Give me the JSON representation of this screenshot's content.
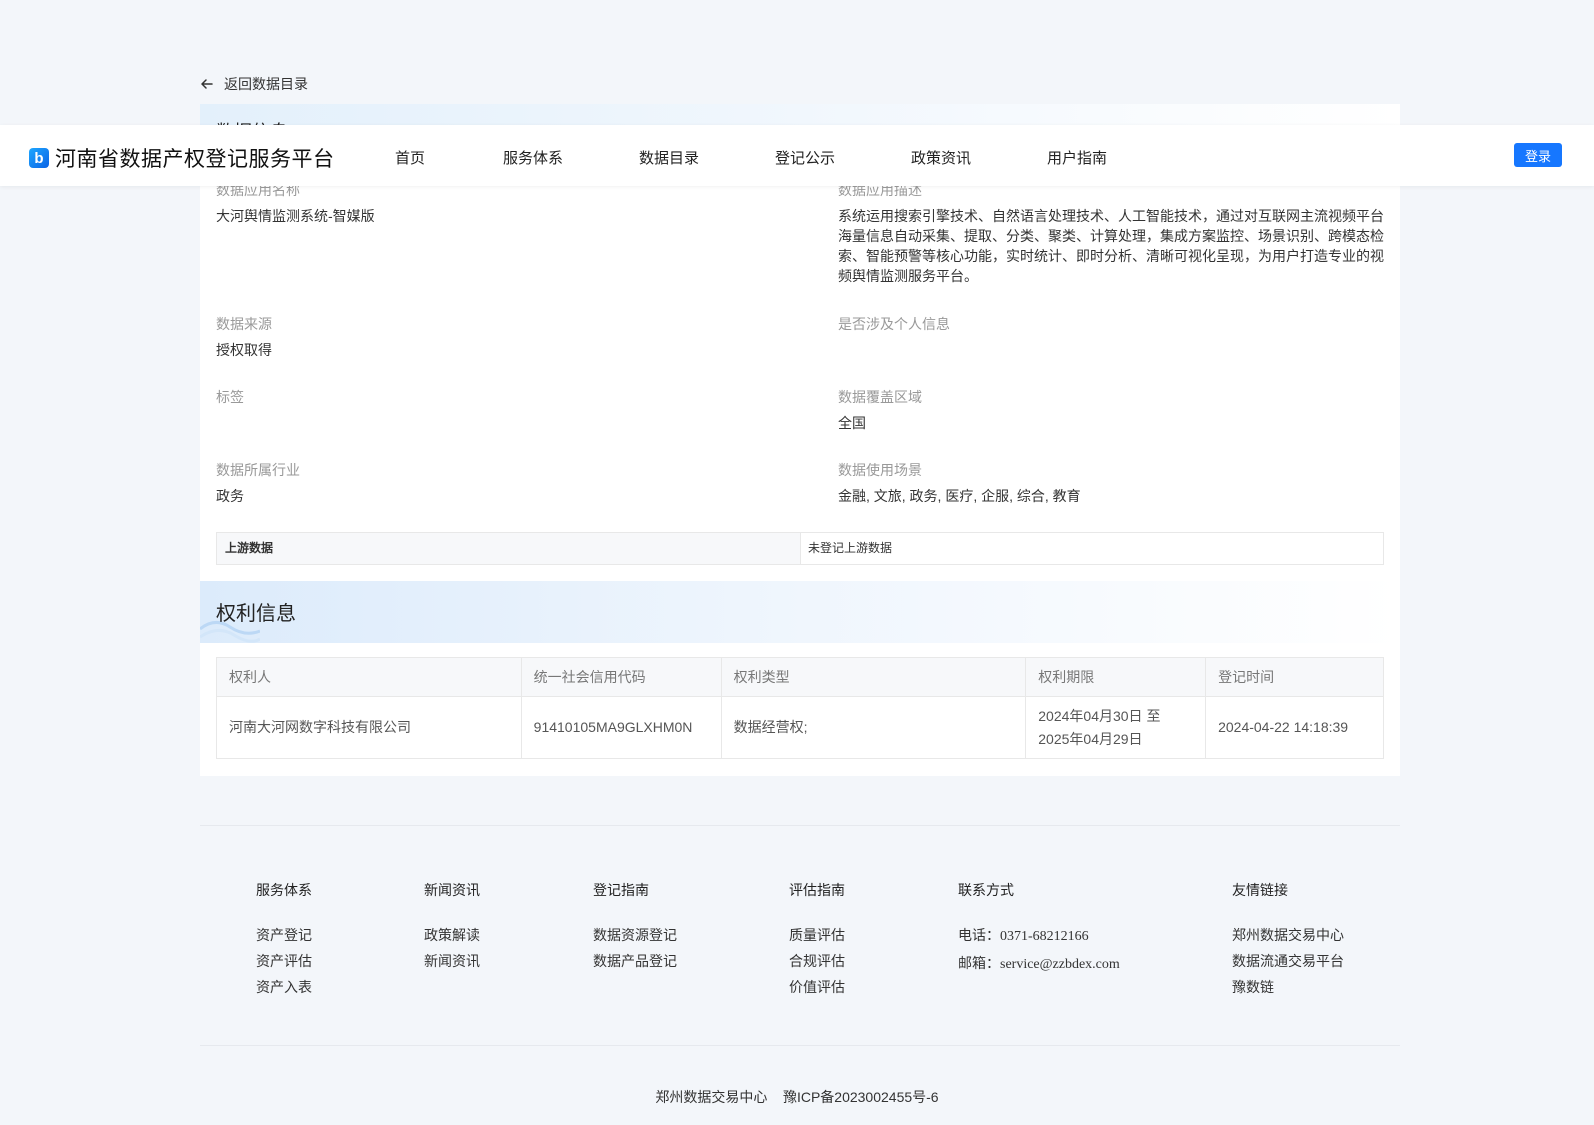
{
  "back": {
    "label": "返回数据目录"
  },
  "partial_title": "数据信息",
  "header": {
    "logo_mark": "b",
    "title": "河南省数据产权登记服务平台",
    "nav": [
      "首页",
      "服务体系",
      "数据目录",
      "登记公示",
      "政策资讯",
      "用户指南"
    ],
    "login": "登录"
  },
  "fields": {
    "app_name": {
      "label": "数据应用名称",
      "value": "大河舆情监测系统-智媒版"
    },
    "app_desc": {
      "label": "数据应用描述",
      "value": "系统运用搜索引擎技术、自然语言处理技术、人工智能技术，通过对互联网主流视频平台海量信息自动采集、提取、分类、聚类、计算处理，集成方案监控、场景识别、跨模态检索、智能预警等核心功能，实时统计、即时分析、清晰可视化呈现，为用户打造专业的视频舆情监测服务平台。"
    },
    "source": {
      "label": "数据来源",
      "value": "授权取得"
    },
    "personal": {
      "label": "是否涉及个人信息",
      "value": ""
    },
    "tags": {
      "label": "标签",
      "value": ""
    },
    "region": {
      "label": "数据覆盖区域",
      "value": "全国"
    },
    "industry": {
      "label": "数据所属行业",
      "value": "政务"
    },
    "scenario": {
      "label": "数据使用场景",
      "value": "金融, 文旅, 政务, 医疗, 企服, 综合, 教育"
    }
  },
  "upstream": {
    "label": "上游数据",
    "value": "未登记上游数据"
  },
  "rights": {
    "title": "权利信息",
    "columns": [
      "权利人",
      "统一社会信用代码",
      "权利类型",
      "权利期限",
      "登记时间"
    ],
    "row": {
      "holder": "河南大河网数字科技有限公司",
      "code": "91410105MA9GLXHM0N",
      "type": "数据经营权;",
      "period_start": "2024年04月30日 至",
      "period_end": "2025年04月29日",
      "reg_time": "2024-04-22 14:18:39"
    }
  },
  "footer": {
    "service": {
      "title": "服务体系",
      "links": [
        "资产登记",
        "资产评估",
        "资产入表"
      ]
    },
    "news": {
      "title": "新闻资讯",
      "links": [
        "政策解读",
        "新闻资讯"
      ]
    },
    "guide": {
      "title": "登记指南",
      "links": [
        "数据资源登记",
        "数据产品登记"
      ]
    },
    "eval": {
      "title": "评估指南",
      "links": [
        "质量评估",
        "合规评估",
        "价值评估"
      ]
    },
    "contact": {
      "title": "联系方式",
      "phone_label": "电话：",
      "phone": "0371-68212166",
      "email_label": "邮箱：",
      "email": "service@zzbdex.com"
    },
    "friends": {
      "title": "友情链接",
      "links": [
        "郑州数据交易中心",
        "数据流通交易平台",
        "豫数链"
      ]
    },
    "copyright": "郑州数据交易中心    豫ICP备2023002455号-6"
  }
}
